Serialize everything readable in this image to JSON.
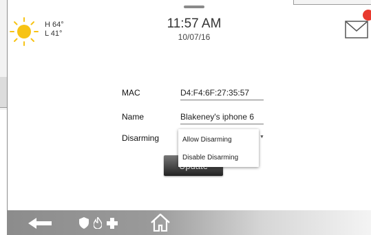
{
  "weather": {
    "high": "H 64°",
    "low": "L 41°",
    "icon": "sun-icon"
  },
  "header": {
    "time": "11:57 AM",
    "date": "10/07/16",
    "mail_icon": "envelope-icon",
    "badge_color": "#e83a2f"
  },
  "form": {
    "mac_label": "MAC",
    "mac_value": "D4:F4:6F:27:35:57",
    "name_label": "Name",
    "name_value": "Blakeney's iphone 6",
    "disarming_label": "Disarming",
    "disarming_options": [
      "Allow Disarming",
      "Disable Disarming"
    ]
  },
  "actions": {
    "update_label": "Update"
  },
  "nav": {
    "items": [
      "back-arrow-icon",
      "security-shield-icon",
      "fire-icon",
      "medical-cross-icon",
      "home-icon"
    ]
  },
  "colors": {
    "sun": "#f7c315",
    "nav_bar": "#8c8c8c"
  }
}
